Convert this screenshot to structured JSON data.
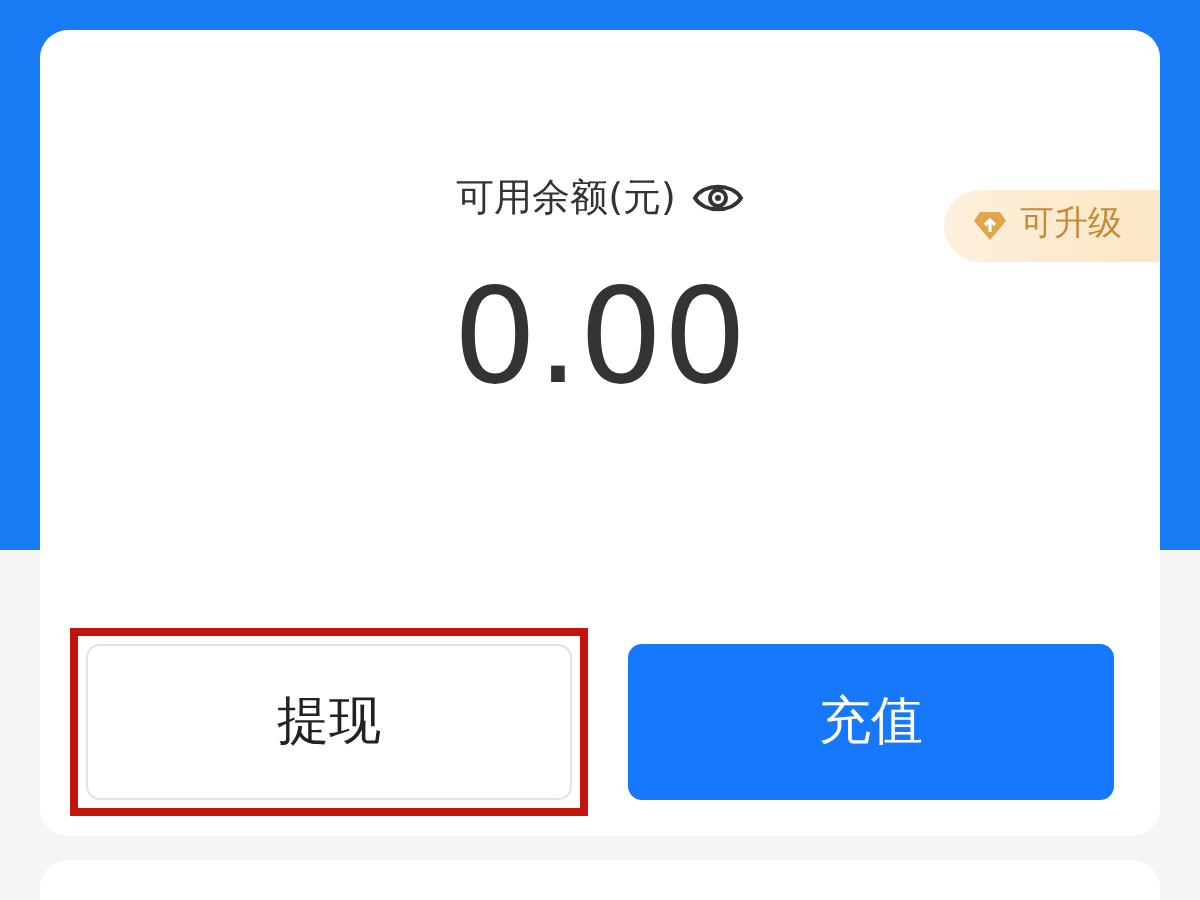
{
  "balance": {
    "label": "可用余额(元)",
    "amount": "0.00",
    "badge": "可升级"
  },
  "buttons": [
    {
      "label": "提现",
      "kind": "outline",
      "highlighted": true
    },
    {
      "label": "充值",
      "kind": "primary",
      "highlighted": false
    }
  ]
}
